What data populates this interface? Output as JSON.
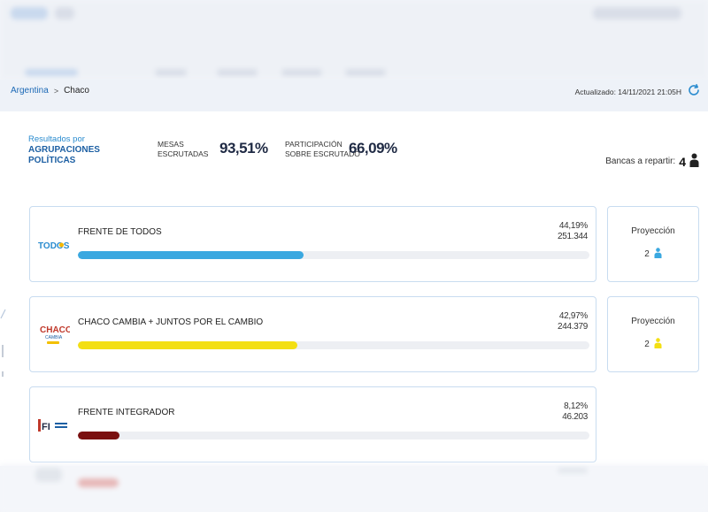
{
  "breadcrumb": {
    "country": "Argentina",
    "separator": ">",
    "province": "Chaco"
  },
  "updated": "Actualizado: 14/11/2021 21:05H",
  "summary": {
    "results_prefix": "Resultados por",
    "results_main": "AGRUPACIONES POLÍTICAS",
    "mesas_label_1": "MESAS",
    "mesas_label_2": "ESCRUTADAS",
    "mesas_value": "93,51%",
    "participacion_label_1": "PARTICIPACIÓN",
    "participacion_label_2": "SOBRE ESCRUTADO",
    "participacion_value": "66,09%",
    "bancas_label": "Bancas a repartir:",
    "bancas_value": "4"
  },
  "parties": [
    {
      "name": "FRENTE DE TODOS",
      "pct": "44,19%",
      "votes": "251.344",
      "share": 44.19,
      "color": "#3aa8e0",
      "logo_text": "TODOS",
      "projection_title": "Proyección",
      "projection_seats": "2",
      "projection_color": "#3aa8e0"
    },
    {
      "name": "CHACO CAMBIA + JUNTOS POR EL CAMBIO",
      "pct": "42,97%",
      "votes": "244.379",
      "share": 42.97,
      "color": "#f3df13",
      "logo_text": "CHACO",
      "logo_sub": "CAMBIA",
      "projection_title": "Proyección",
      "projection_seats": "2",
      "projection_color": "#f3df13"
    },
    {
      "name": "FRENTE INTEGRADOR",
      "pct": "8,12%",
      "votes": "46.203",
      "share": 8.12,
      "color": "#7a1010",
      "logo_text": "FI"
    }
  ]
}
